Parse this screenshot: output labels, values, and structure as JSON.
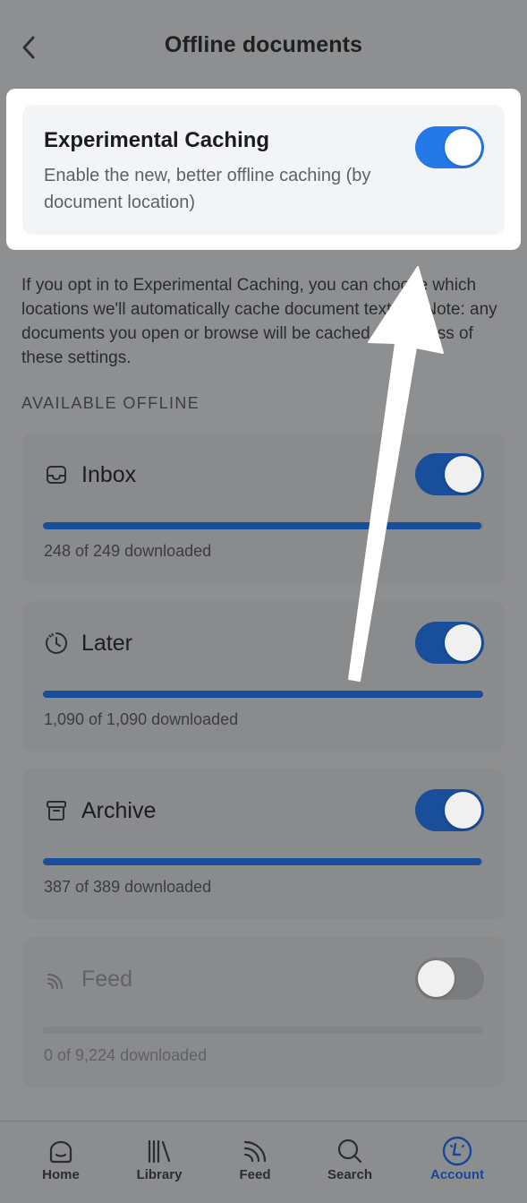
{
  "header": {
    "title": "Offline documents"
  },
  "experimental": {
    "title": "Experimental Caching",
    "description": "Enable the new, better offline caching (by document location)",
    "enabled": true
  },
  "intro": "If you opt in to Experimental Caching, you can choose which locations we'll automatically cache document text for. Note: any documents you open or browse will be cached regardless of these settings.",
  "section_label": "AVAILABLE OFFLINE",
  "locations": [
    {
      "icon": "inbox-icon",
      "title": "Inbox",
      "enabled": true,
      "progress": 0.996,
      "status": "248 of 249 downloaded"
    },
    {
      "icon": "clock-icon",
      "title": "Later",
      "enabled": true,
      "progress": 1.0,
      "status": "1,090 of 1,090 downloaded"
    },
    {
      "icon": "archive-icon",
      "title": "Archive",
      "enabled": true,
      "progress": 0.995,
      "status": "387 of 389 downloaded"
    },
    {
      "icon": "rss-feed-icon",
      "title": "Feed",
      "enabled": false,
      "progress": 0,
      "status": "0 of 9,224 downloaded"
    }
  ],
  "tabbar": {
    "tabs": [
      {
        "icon": "home-icon",
        "label": "Home"
      },
      {
        "icon": "library-icon",
        "label": "Library"
      },
      {
        "icon": "feed-icon",
        "label": "Feed"
      },
      {
        "icon": "search-icon",
        "label": "Search"
      },
      {
        "icon": "account-icon",
        "label": "Account"
      }
    ],
    "active": "Account"
  },
  "colors": {
    "toggle_on_bright": "#2478e8",
    "toggle_on_dimmed": "#184e9a",
    "accent_active_tab": "#17479a",
    "overlay_gray": "#8e8f90"
  }
}
